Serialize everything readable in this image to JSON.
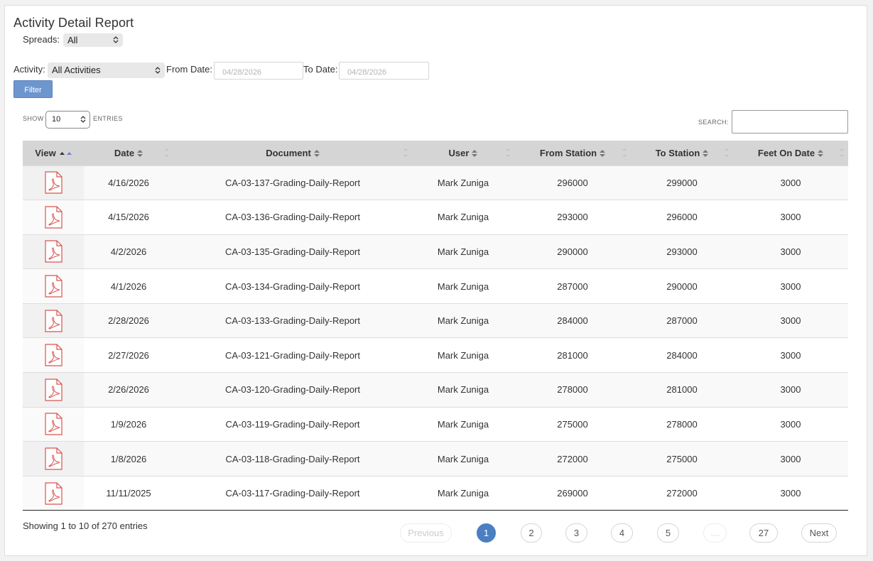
{
  "page": {
    "title": "Activity Detail Report"
  },
  "filters": {
    "spreads_label": "Spreads:",
    "spreads_value": "All",
    "activity_label": "Activity:",
    "activity_value": "All Activities",
    "from_label": "From Date:",
    "from_value": "04/28/2026",
    "to_label": "To Date:",
    "to_value": "04/28/2026",
    "filter_button": "Filter"
  },
  "table_controls": {
    "show_label": "SHOW",
    "entries_value": "10",
    "entries_label": "ENTRIES",
    "search_label": "SEARCH:",
    "search_value": ""
  },
  "table": {
    "columns": [
      "View",
      "Date",
      "Document",
      "User",
      "From Station",
      "To Station",
      "Feet On Date"
    ],
    "rows": [
      {
        "view_icon": "pdf-icon",
        "date": "4/16/2026",
        "document": "CA-03-137-Grading-Daily-Report",
        "user": "Mark Zuniga",
        "from_station": "296000",
        "to_station": "299000",
        "feet": "3000"
      },
      {
        "view_icon": "pdf-icon",
        "date": "4/15/2026",
        "document": "CA-03-136-Grading-Daily-Report",
        "user": "Mark Zuniga",
        "from_station": "293000",
        "to_station": "296000",
        "feet": "3000"
      },
      {
        "view_icon": "pdf-icon",
        "date": "4/2/2026",
        "document": "CA-03-135-Grading-Daily-Report",
        "user": "Mark Zuniga",
        "from_station": "290000",
        "to_station": "293000",
        "feet": "3000"
      },
      {
        "view_icon": "pdf-icon",
        "date": "4/1/2026",
        "document": "CA-03-134-Grading-Daily-Report",
        "user": "Mark Zuniga",
        "from_station": "287000",
        "to_station": "290000",
        "feet": "3000"
      },
      {
        "view_icon": "pdf-icon",
        "date": "2/28/2026",
        "document": "CA-03-133-Grading-Daily-Report",
        "user": "Mark Zuniga",
        "from_station": "284000",
        "to_station": "287000",
        "feet": "3000"
      },
      {
        "view_icon": "pdf-icon",
        "date": "2/27/2026",
        "document": "CA-03-121-Grading-Daily-Report",
        "user": "Mark Zuniga",
        "from_station": "281000",
        "to_station": "284000",
        "feet": "3000"
      },
      {
        "view_icon": "pdf-icon",
        "date": "2/26/2026",
        "document": "CA-03-120-Grading-Daily-Report",
        "user": "Mark Zuniga",
        "from_station": "278000",
        "to_station": "281000",
        "feet": "3000"
      },
      {
        "view_icon": "pdf-icon",
        "date": "1/9/2026",
        "document": "CA-03-119-Grading-Daily-Report",
        "user": "Mark Zuniga",
        "from_station": "275000",
        "to_station": "278000",
        "feet": "3000"
      },
      {
        "view_icon": "pdf-icon",
        "date": "1/8/2026",
        "document": "CA-03-118-Grading-Daily-Report",
        "user": "Mark Zuniga",
        "from_station": "272000",
        "to_station": "275000",
        "feet": "3000"
      },
      {
        "view_icon": "pdf-icon",
        "date": "11/11/2025",
        "document": "CA-03-117-Grading-Daily-Report",
        "user": "Mark Zuniga",
        "from_station": "269000",
        "to_station": "272000",
        "feet": "3000"
      }
    ],
    "sorted_column": "View",
    "sort_direction": "ascending"
  },
  "footer": {
    "info": "Showing 1 to 10 of 270 entries",
    "pagination": {
      "previous": "Previous",
      "pages": [
        "1",
        "2",
        "3",
        "4",
        "5",
        "…",
        "27"
      ],
      "current": "1",
      "next": "Next"
    }
  },
  "colors": {
    "accent": "#4a7fc1",
    "filter_button": "#6d96cf",
    "header_bg": "#d5d5d5",
    "pdf_icon": "#d9534f"
  }
}
